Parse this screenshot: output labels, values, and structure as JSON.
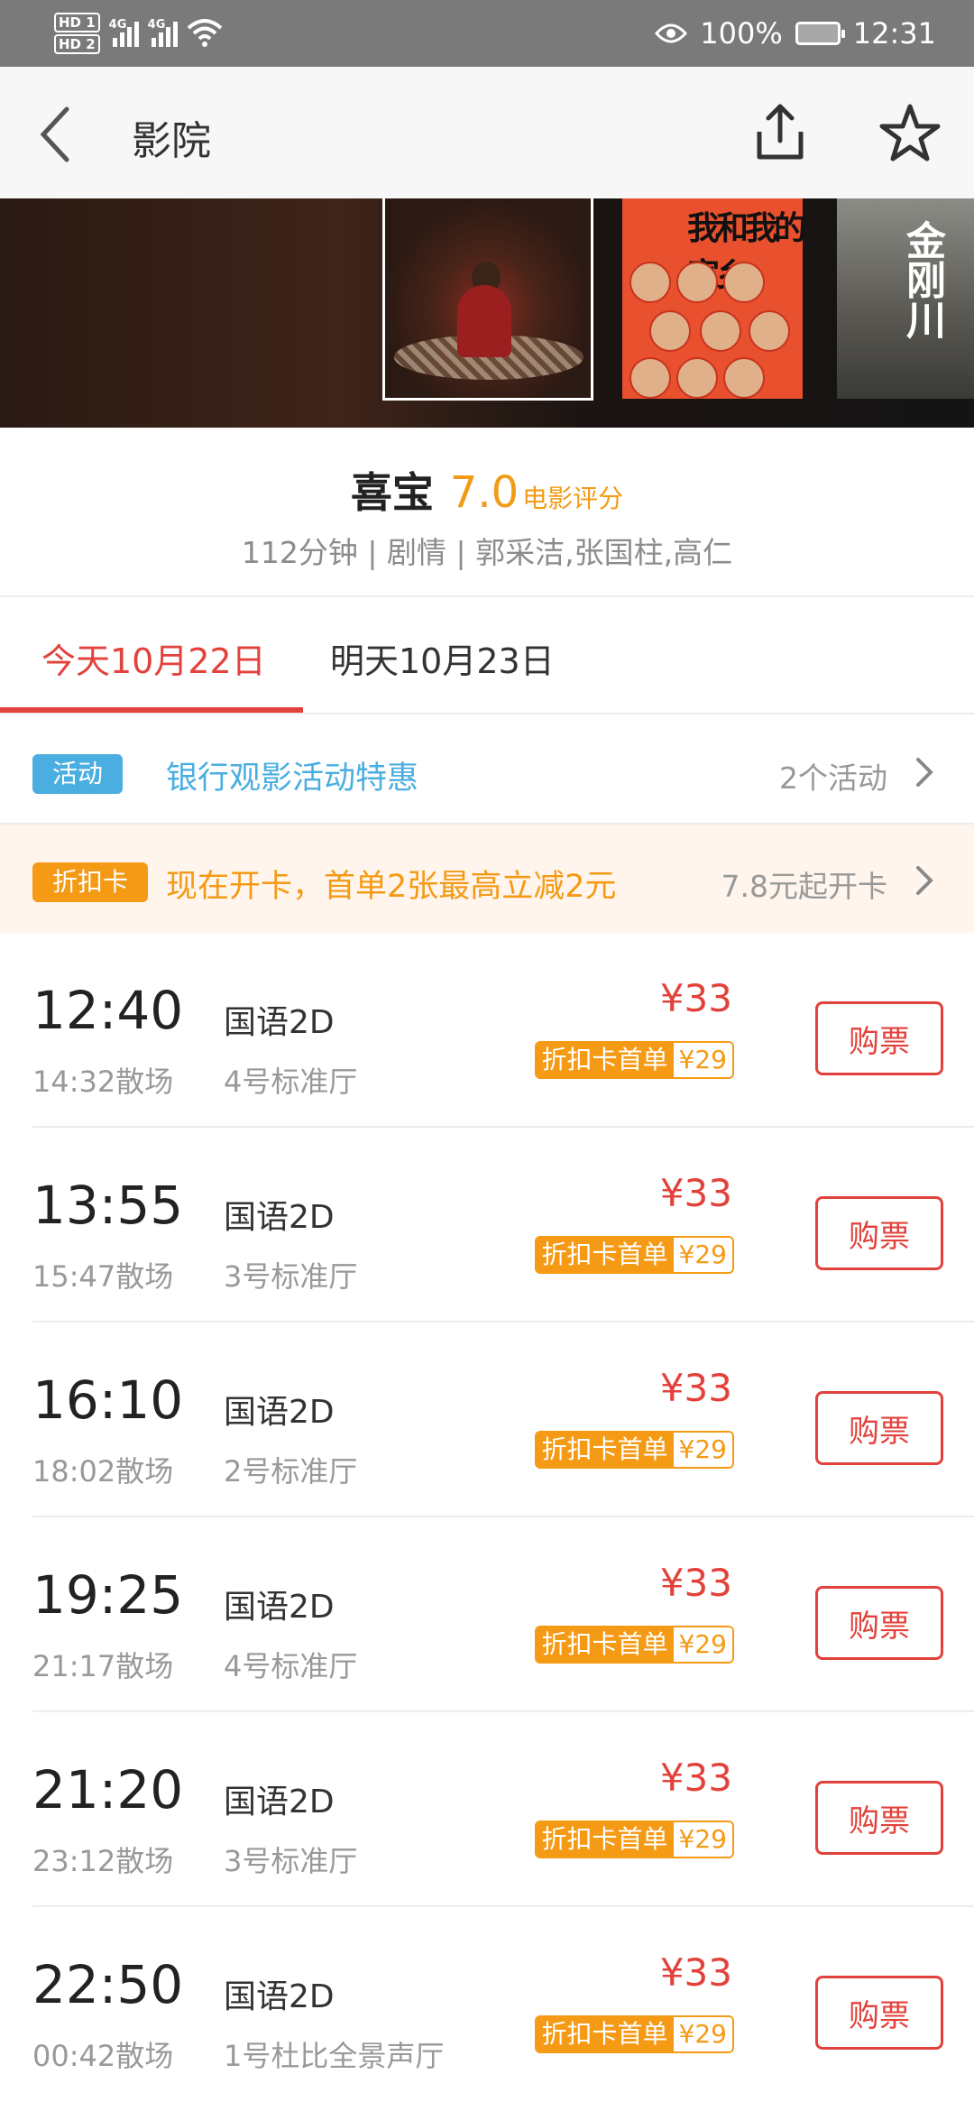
{
  "status_bar": {
    "hd1": "HD 1",
    "hd2": "HD 2",
    "net1": "4G",
    "net2": "4G",
    "battery": "100%",
    "time": "12:31",
    "icons": [
      "hd-icon",
      "signal-icon",
      "wifi-icon",
      "eye-icon",
      "battery-icon"
    ]
  },
  "header": {
    "title": "影院",
    "back_icon": "chevron-left-icon",
    "share_icon": "share-icon",
    "favorite_icon": "star-icon"
  },
  "posters": {
    "p2_title": "我和我的家乡",
    "p3_title": "金刚川"
  },
  "movie": {
    "name": "喜宝",
    "score": "7.0",
    "score_label": "电影评分",
    "meta": "112分钟 | 剧情 | 郭采洁,张国柱,高仁"
  },
  "dates": {
    "today": "今天10月22日",
    "tomorrow": "明天10月23日"
  },
  "promo_activity": {
    "tag": "活动",
    "desc": "银行观影活动特惠",
    "count": "2个活动"
  },
  "promo_card": {
    "tag": "折扣卡",
    "desc": "现在开卡，首单2张最高立减2元",
    "count": "7.8元起开卡"
  },
  "showtimes": [
    {
      "time": "12:40",
      "end": "14:32散场",
      "lang": "国语2D",
      "hall": "4号标准厅",
      "price": "¥33",
      "card_label": "折扣卡首单",
      "card_price": "¥29",
      "buy": "购票"
    },
    {
      "time": "13:55",
      "end": "15:47散场",
      "lang": "国语2D",
      "hall": "3号标准厅",
      "price": "¥33",
      "card_label": "折扣卡首单",
      "card_price": "¥29",
      "buy": "购票"
    },
    {
      "time": "16:10",
      "end": "18:02散场",
      "lang": "国语2D",
      "hall": "2号标准厅",
      "price": "¥33",
      "card_label": "折扣卡首单",
      "card_price": "¥29",
      "buy": "购票"
    },
    {
      "time": "19:25",
      "end": "21:17散场",
      "lang": "国语2D",
      "hall": "4号标准厅",
      "price": "¥33",
      "card_label": "折扣卡首单",
      "card_price": "¥29",
      "buy": "购票"
    },
    {
      "time": "21:20",
      "end": "23:12散场",
      "lang": "国语2D",
      "hall": "3号标准厅",
      "price": "¥33",
      "card_label": "折扣卡首单",
      "card_price": "¥29",
      "buy": "购票"
    },
    {
      "time": "22:50",
      "end": "00:42散场",
      "lang": "国语2D",
      "hall": "1号杜比全景声厅",
      "price": "¥33",
      "card_label": "折扣卡首单",
      "card_price": "¥29",
      "buy": "购票"
    }
  ],
  "colors": {
    "accent_red": "#e2423b",
    "score_orange": "#f29b16",
    "activity_blue": "#4aaee0",
    "card_orange": "#f59a14"
  }
}
